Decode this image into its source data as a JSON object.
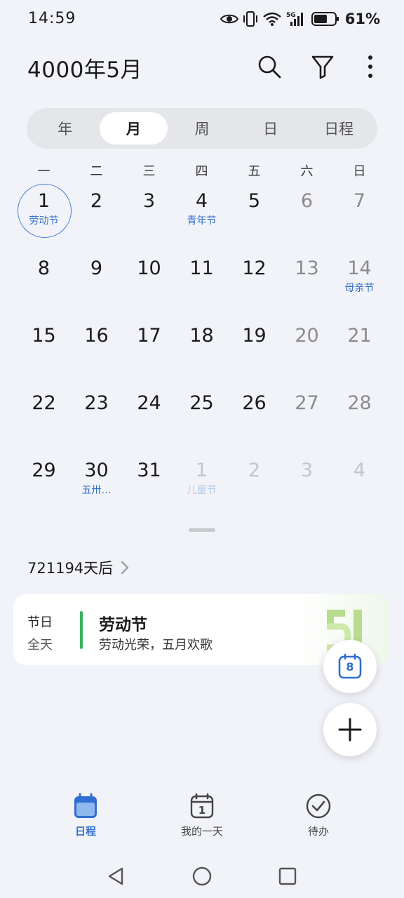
{
  "status_bar": {
    "time": "14:59",
    "battery": "61%"
  },
  "header": {
    "title": "4000年5月"
  },
  "view_tabs": [
    {
      "label": "年",
      "active": false
    },
    {
      "label": "月",
      "active": true
    },
    {
      "label": "周",
      "active": false
    },
    {
      "label": "日",
      "active": false
    },
    {
      "label": "日程",
      "active": false
    }
  ],
  "weekdays": [
    "一",
    "二",
    "三",
    "四",
    "五",
    "六",
    "日"
  ],
  "calendar": {
    "days": [
      {
        "num": "1",
        "sub": "劳动节",
        "today": true
      },
      {
        "num": "2",
        "sub": ""
      },
      {
        "num": "3",
        "sub": ""
      },
      {
        "num": "4",
        "sub": "青年节"
      },
      {
        "num": "5",
        "sub": ""
      },
      {
        "num": "6",
        "sub": ""
      },
      {
        "num": "7",
        "sub": ""
      },
      {
        "num": "8",
        "sub": ""
      },
      {
        "num": "9",
        "sub": ""
      },
      {
        "num": "10",
        "sub": ""
      },
      {
        "num": "11",
        "sub": ""
      },
      {
        "num": "12",
        "sub": ""
      },
      {
        "num": "13",
        "sub": ""
      },
      {
        "num": "14",
        "sub": "母亲节"
      },
      {
        "num": "15",
        "sub": ""
      },
      {
        "num": "16",
        "sub": ""
      },
      {
        "num": "17",
        "sub": ""
      },
      {
        "num": "18",
        "sub": ""
      },
      {
        "num": "19",
        "sub": ""
      },
      {
        "num": "20",
        "sub": ""
      },
      {
        "num": "21",
        "sub": ""
      },
      {
        "num": "22",
        "sub": ""
      },
      {
        "num": "23",
        "sub": ""
      },
      {
        "num": "24",
        "sub": ""
      },
      {
        "num": "25",
        "sub": ""
      },
      {
        "num": "26",
        "sub": ""
      },
      {
        "num": "27",
        "sub": ""
      },
      {
        "num": "28",
        "sub": ""
      },
      {
        "num": "29",
        "sub": ""
      },
      {
        "num": "30",
        "sub": "五卅…"
      },
      {
        "num": "31",
        "sub": ""
      },
      {
        "num": "1",
        "sub": "儿童节",
        "other": true
      },
      {
        "num": "2",
        "sub": "",
        "other": true
      },
      {
        "num": "3",
        "sub": "",
        "other": true
      },
      {
        "num": "4",
        "sub": "",
        "other": true
      }
    ]
  },
  "countdown": {
    "text": "721194天后"
  },
  "event": {
    "type": "节日",
    "time": "全天",
    "title": "劳动节",
    "description": "劳动光荣，五月欢歌",
    "accent_color": "#36b35a"
  },
  "fab": {
    "today_number": "8"
  },
  "bottom_nav": [
    {
      "label": "日程",
      "icon": "calendar-filled-icon",
      "active": true
    },
    {
      "label": "我的一天",
      "icon": "calendar-day-icon",
      "number": "1",
      "active": false
    },
    {
      "label": "待办",
      "icon": "check-circle-icon",
      "active": false
    }
  ],
  "colors": {
    "accent": "#2f6fd0",
    "background": "#f1f3f8",
    "holiday_green": "#36b35a"
  }
}
